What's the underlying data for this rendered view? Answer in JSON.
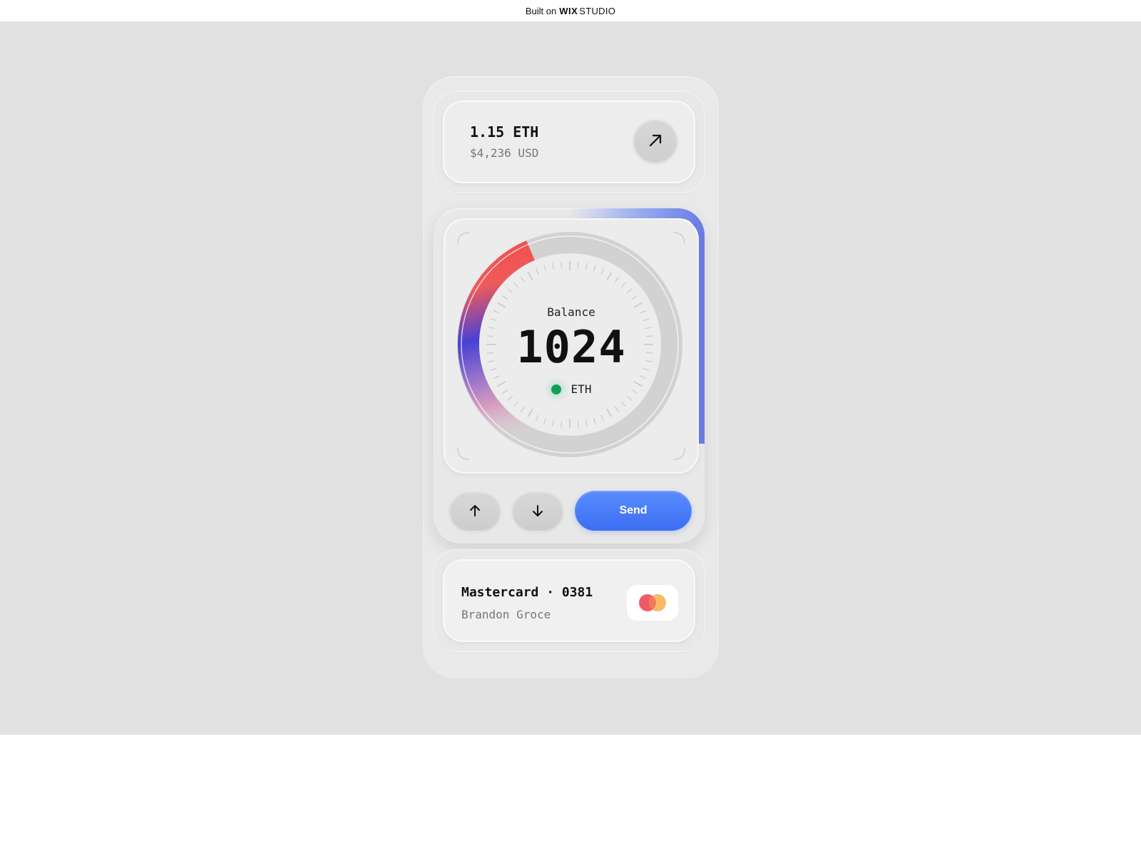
{
  "topbar": {
    "built_on": "Built on",
    "brand": "WIX",
    "product": "STUDIO"
  },
  "balance_card": {
    "eth_amount": "1.15 ETH",
    "usd_amount": "$4,236 USD",
    "action_icon": "arrow-up-right-icon"
  },
  "dial": {
    "label": "Balance",
    "value": "1024",
    "currency": "ETH",
    "status_color": "#0fa15a"
  },
  "actions": {
    "up_icon": "arrow-up-icon",
    "down_icon": "arrow-down-icon",
    "send_label": "Send",
    "send_color": "#4a7cf8"
  },
  "payment_card": {
    "card_label": "Mastercard · 0381",
    "holder": "Brandon Groce",
    "logo_icon": "mastercard-logo-icon",
    "logo_colors": [
      "#ef5a6a",
      "#f8b35b"
    ]
  },
  "colors": {
    "background": "#e1e1e1",
    "accent_blue": "#4a7cf8",
    "gauge_gradient": [
      "#e84f4f",
      "#4a45d8",
      "#d8a0c0"
    ]
  }
}
